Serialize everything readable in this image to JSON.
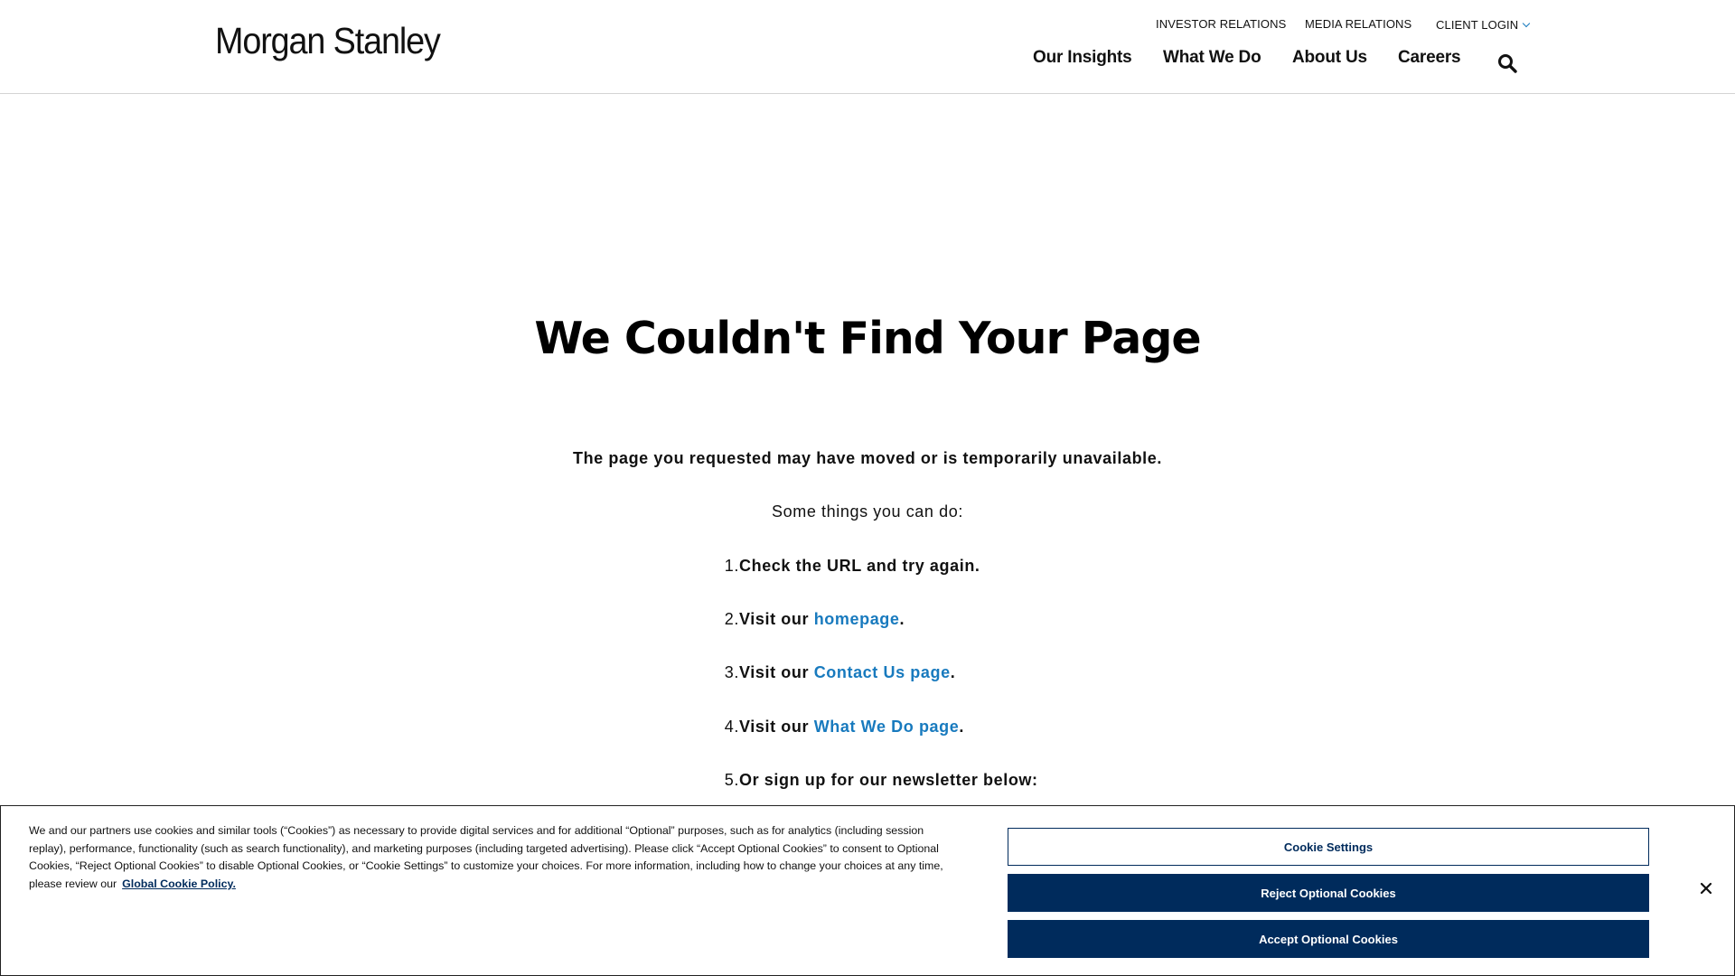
{
  "header": {
    "logo": "Morgan Stanley",
    "utility_links": {
      "investor_relations": "INVESTOR RELATIONS",
      "media_relations": "MEDIA RELATIONS",
      "client_login": "CLIENT LOGIN"
    },
    "nav": {
      "our_insights": "Our Insights",
      "what_we_do": "What We Do",
      "about_us": "About Us",
      "careers": "Careers"
    },
    "search_icon": "search-icon"
  },
  "main": {
    "title": "We Couldn't Find Your Page",
    "lead": "The page you requested may have moved or is temporarily unavailable.",
    "intro": "Some things you can do:",
    "steps": [
      {
        "num": "1.",
        "text": "Check the URL and try again."
      },
      {
        "num": "2.",
        "prefix": "Visit our ",
        "link": "homepage",
        "suffix": "."
      },
      {
        "num": "3.",
        "prefix": "Visit our ",
        "link": "Contact Us page",
        "suffix": "."
      },
      {
        "num": "4.",
        "prefix": "Visit our ",
        "link": "What We Do page",
        "suffix": "."
      },
      {
        "num": "5.",
        "text": "Or sign up for our newsletter below:"
      }
    ]
  },
  "cookie_banner": {
    "text": "We and our partners use cookies and similar tools (“Cookies”) as necessary to provide digital services and for additional “Optional” purposes, such as for analytics (including session replay), performance, functionality (such as search functionality), and marketing purposes (including targeted advertising). Please click “Accept Optional Cookies” to consent to Optional Cookies, “Reject Optional Cookies” to disable Optional Cookies, or “Cookie Settings” to customize your choices. For more information, including how to change your choices at any time, please review our",
    "policy_link": "Global Cookie Policy.",
    "settings_button": "Cookie Settings",
    "reject_button": "Reject Optional Cookies",
    "accept_button": "Accept Optional Cookies",
    "close_icon": "close-icon"
  },
  "colors": {
    "link_blue": "#187abe",
    "navy": "#002b5c"
  }
}
